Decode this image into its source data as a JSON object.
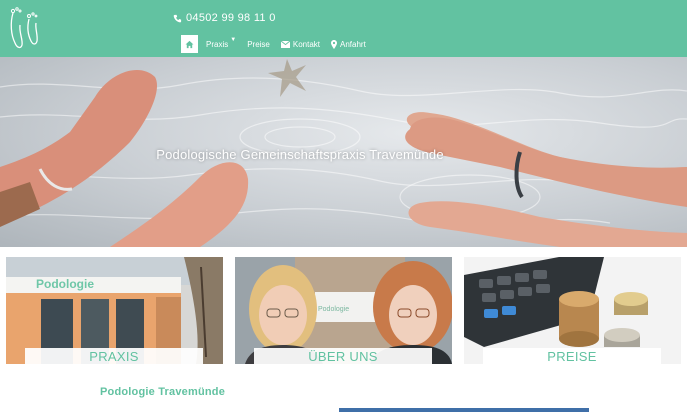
{
  "header": {
    "phone": "04502 99 98 11 0",
    "nav": [
      {
        "label": "Praxis"
      },
      {
        "label": "Preise"
      },
      {
        "label": "Kontakt"
      },
      {
        "label": "Anfahrt"
      }
    ]
  },
  "hero": {
    "title": "Podologische Gemeinschaftspraxis Travemünde"
  },
  "cards": [
    {
      "label": "PRAXIS",
      "sign": "Podologie"
    },
    {
      "label": "ÜBER UNS",
      "sign": "Podologie"
    },
    {
      "label": "PREISE"
    }
  ],
  "main": {
    "subheading": "Podologie Travemünde"
  },
  "colors": {
    "brand": "#62c2a1",
    "white": "#ffffff"
  }
}
